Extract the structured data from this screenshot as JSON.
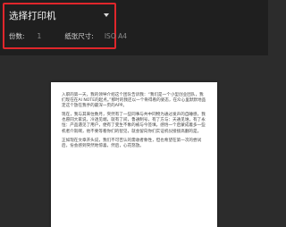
{
  "print_settings": {
    "printer_title": "选择打印机",
    "copies_label": "份数:",
    "copies_value": "1",
    "paper_size_label": "纸张尺寸:",
    "paper_size_value": "ISO A4"
  },
  "preview": {
    "paragraphs": [
      "入职的第一天，我的领导介绍这个团队告诉我：“我们是一个小型创业团队，我们现在在AI NOTE的起点。”那时的我还以一个骨得看的姿态，在众心里默默地品定这个放在我手的最深一页的APP。",
      "现在，我与其来住数月，突然有了一些同事与共中同物为通过发声的自睡感，我也愿同大家说，冷透见端，就有了间，鲁通制号，有了方与：天通见谁，有了永恒：产品遇见了用户，便有了变生不象的被与今签填。感悟一个启蒙成着多一些机者介就啊，他不要等看你们的智见，就会留向你们实证机仪接接高翻的是。",
      "正如现在文章开头说，我们不可否认的需收者象性，但也希望在第一次的尝试后，份会感到突然地惊喜，然后，心花怒放。"
    ]
  }
}
